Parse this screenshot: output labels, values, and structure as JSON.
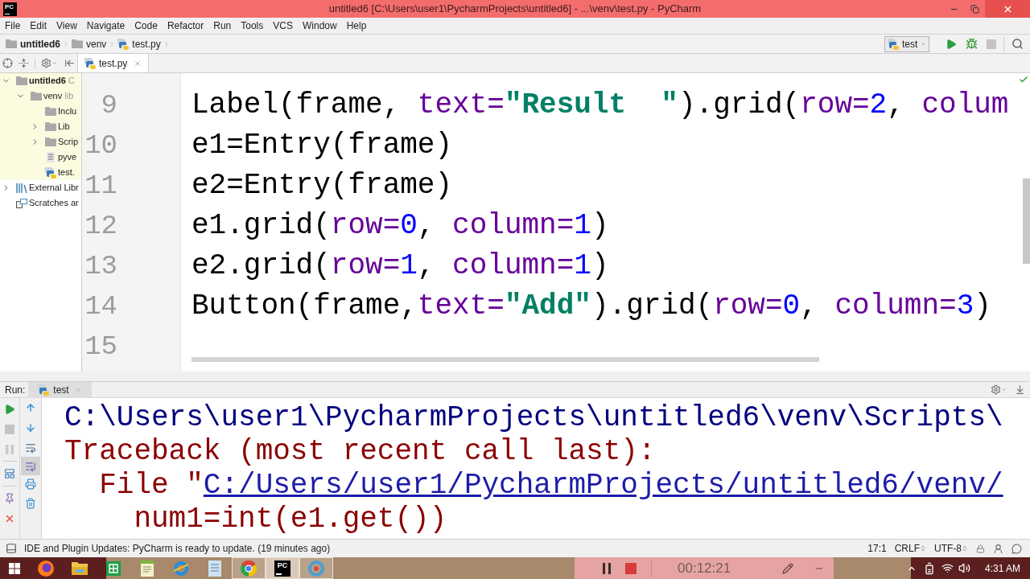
{
  "title_bar": {
    "logo_text": "PC",
    "title": "untitled6 [C:\\Users\\user1\\PycharmProjects\\untitled6] - ...\\venv\\test.py - PyCharm"
  },
  "menu": [
    "File",
    "Edit",
    "View",
    "Navigate",
    "Code",
    "Refactor",
    "Run",
    "Tools",
    "VCS",
    "Window",
    "Help"
  ],
  "navigation": {
    "breadcrumbs": [
      {
        "kind": "project",
        "label": "untitled6"
      },
      {
        "kind": "folder",
        "label": "venv"
      },
      {
        "kind": "python_file",
        "label": "test.py"
      }
    ],
    "run_config": "test",
    "stop": {
      "disabled": true
    }
  },
  "editor_tabs": [
    {
      "label": "test.py",
      "selected": true
    }
  ],
  "project_tree": [
    {
      "kind": "project",
      "label": "untitled6",
      "suffix": "C",
      "expanded": true,
      "highlighted": true,
      "children": [
        {
          "kind": "folder",
          "label": "venv",
          "suffix": "lib",
          "expanded": true,
          "highlighted": true,
          "children": [
            {
              "kind": "folder",
              "label": "Inclu",
              "highlighted": true
            },
            {
              "kind": "folder",
              "label": "Lib",
              "expanded": false,
              "highlighted": true
            },
            {
              "kind": "folder",
              "label": "Scrip",
              "expanded": false,
              "highlighted": true
            },
            {
              "kind": "text_file",
              "label": "pyve",
              "highlighted": true
            },
            {
              "kind": "python_file",
              "label": "test.",
              "highlighted": true
            }
          ]
        }
      ]
    },
    {
      "kind": "library",
      "label": "External Libr",
      "expanded": false,
      "highlighted": false
    },
    {
      "kind": "scratches",
      "label": "Scratches ar",
      "highlighted": false
    }
  ],
  "editor": {
    "lines": [
      {
        "number": "9",
        "tokens": [
          {
            "kind": "plain",
            "text": "Label(frame, "
          },
          {
            "kind": "kwarg",
            "text": "text="
          },
          {
            "kind": "string",
            "text": "\"Result  \""
          },
          {
            "kind": "plain",
            "text": ").grid("
          },
          {
            "kind": "kwarg",
            "text": "row="
          },
          {
            "kind": "number",
            "text": "2"
          },
          {
            "kind": "plain",
            "text": ", "
          },
          {
            "kind": "kwarg",
            "text": "colum"
          }
        ]
      },
      {
        "number": "10",
        "tokens": [
          {
            "kind": "plain",
            "text": "e1=Entry(frame)"
          }
        ]
      },
      {
        "number": "11",
        "tokens": [
          {
            "kind": "plain",
            "text": "e2=Entry(frame)"
          }
        ]
      },
      {
        "number": "12",
        "tokens": [
          {
            "kind": "plain",
            "text": "e1.grid("
          },
          {
            "kind": "kwarg",
            "text": "row="
          },
          {
            "kind": "number",
            "text": "0"
          },
          {
            "kind": "plain",
            "text": ", "
          },
          {
            "kind": "kwarg",
            "text": "column="
          },
          {
            "kind": "number",
            "text": "1"
          },
          {
            "kind": "plain",
            "text": ")"
          }
        ]
      },
      {
        "number": "13",
        "tokens": [
          {
            "kind": "plain",
            "text": "e2.grid("
          },
          {
            "kind": "kwarg",
            "text": "row="
          },
          {
            "kind": "number",
            "text": "1"
          },
          {
            "kind": "plain",
            "text": ", "
          },
          {
            "kind": "kwarg",
            "text": "column="
          },
          {
            "kind": "number",
            "text": "1"
          },
          {
            "kind": "plain",
            "text": ")"
          }
        ]
      },
      {
        "number": "14",
        "tokens": [
          {
            "kind": "plain",
            "text": "Button(frame,"
          },
          {
            "kind": "kwarg",
            "text": "text="
          },
          {
            "kind": "string",
            "text": "\"Add\""
          },
          {
            "kind": "plain",
            "text": ").grid("
          },
          {
            "kind": "kwarg",
            "text": "row="
          },
          {
            "kind": "number",
            "text": "0"
          },
          {
            "kind": "plain",
            "text": ", "
          },
          {
            "kind": "kwarg",
            "text": "column="
          },
          {
            "kind": "number",
            "text": "3"
          },
          {
            "kind": "plain",
            "text": ")"
          }
        ]
      },
      {
        "number": "15"
      }
    ]
  },
  "run_panel": {
    "title": "Run:",
    "tabs": [
      {
        "label": "test",
        "selected": true
      }
    ],
    "stop": {
      "disabled": true
    },
    "pause": {
      "disabled": true
    },
    "scroll_to_end": {
      "on": true
    },
    "console": [
      {
        "segments": [
          {
            "kind": "path",
            "text": "C:\\Users\\user1\\PycharmProjects\\untitled6\\venv\\Scripts\\"
          }
        ]
      },
      {
        "segments": [
          {
            "kind": "error",
            "text": "Traceback (most recent call last):"
          }
        ]
      },
      {
        "segments": [
          {
            "kind": "error",
            "text": "  File \""
          },
          {
            "kind": "link",
            "text": "C:/Users/user1/PycharmProjects/untitled6/venv/"
          }
        ]
      },
      {
        "segments": [
          {
            "kind": "error",
            "text": "    num1=int(e1.get())"
          }
        ]
      }
    ]
  },
  "status_bar": {
    "message": "IDE and Plugin Updates: PyCharm is ready to update. (19 minutes ago)",
    "position": "17:1",
    "line_separator": "CRLF",
    "encoding": "UTF-8"
  },
  "taskbar": {
    "apps": [
      {
        "kind": "fox_browser",
        "running": false,
        "selected": false
      },
      {
        "kind": "folder",
        "running": false,
        "selected": false
      },
      {
        "kind": "sheet",
        "running": false,
        "selected": false
      },
      {
        "kind": "notepad",
        "running": false,
        "selected": false
      },
      {
        "kind": "e_browser",
        "running": false,
        "selected": false
      },
      {
        "kind": "notes",
        "running": false,
        "selected": false
      },
      {
        "kind": "round_browser",
        "running": true,
        "selected": false
      },
      {
        "kind": "ide",
        "label": "PC",
        "running": true,
        "selected": true
      },
      {
        "kind": "ring_app",
        "running": true,
        "selected": false
      }
    ],
    "clock": "4:31 AM"
  },
  "recorder": {
    "time": "00:12:21"
  }
}
